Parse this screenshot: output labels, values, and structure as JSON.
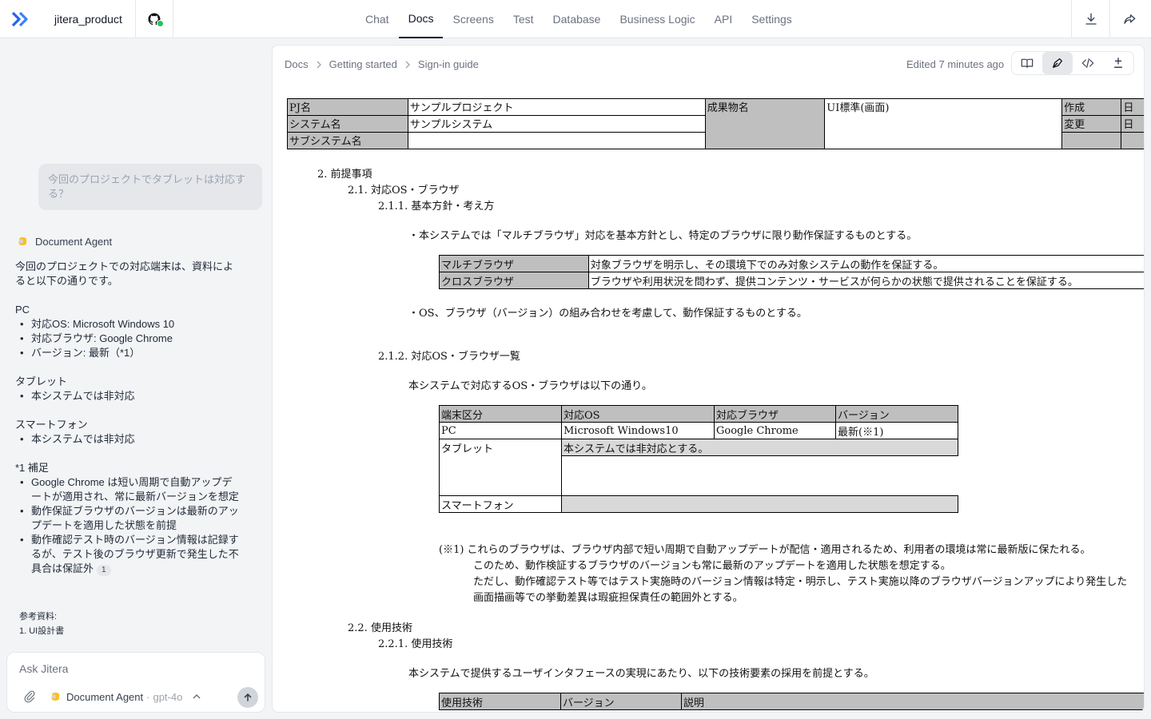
{
  "topbar": {
    "project": "jitera_product",
    "tabs": [
      {
        "label": "Chat"
      },
      {
        "label": "Docs"
      },
      {
        "label": "Screens"
      },
      {
        "label": "Test"
      },
      {
        "label": "Database"
      },
      {
        "label": "Business Logic"
      },
      {
        "label": "API"
      },
      {
        "label": "Settings"
      }
    ],
    "active_tab": "Docs"
  },
  "chat": {
    "user_message": "今回のプロジェクトでタブレットは対応する？",
    "agent_name": "Document Agent",
    "answer_intro": "今回のプロジェクトでの対応端末は、資料によると以下の通りです。",
    "pc_heading": "PC",
    "pc_items": [
      "対応OS: Microsoft Windows 10",
      "対応ブラウザ: Google Chrome",
      "バージョン: 最新（*1）"
    ],
    "tablet_heading": "タブレット",
    "tablet_items": [
      "本システムでは非対応"
    ],
    "phone_heading": "スマートフォン",
    "phone_items": [
      "本システムでは非対応"
    ],
    "note_heading": "*1 補足",
    "note_items": [
      "Google Chrome は短い周期で自動アップデートが適用され、常に最新バージョンを想定",
      "動作保証ブラウザのバージョンは最新のアップデートを適用した状態を前提",
      "動作確認テスト時のバージョン情報は記録するが、テスト後のブラウザ更新で発生した不具合は保証外"
    ],
    "citation": "1",
    "refs_label": "参考資料:",
    "refs": [
      "1. UI設計書"
    ],
    "input_placeholder": "Ask Jitera",
    "model_label": "Document Agent",
    "model_sep": "·",
    "model_name": "gpt-4o"
  },
  "doc_toolbar": {
    "breadcrumb": [
      "Docs",
      "Getting started",
      "Sign-in guide"
    ],
    "edited": "Edited 7 minutes ago"
  },
  "document": {
    "header": {
      "pj_label": "PJ名",
      "pj_value": "サンプルプロジェクト",
      "sys_label": "システム名",
      "sys_value": "サンプルシステム",
      "sub_label": "サブシステム名",
      "sub_value": "",
      "deliverable_label": "成果物名",
      "deliverable_value": "UI標準(画面)",
      "created_label": "作成",
      "changed_label": "変更",
      "created_value": "日",
      "changed_value": "日"
    },
    "s2": "2. 前提事項",
    "s21": "2.1. 対応OS・ブラウザ",
    "s211": "2.1.1. 基本方針・考え方",
    "p1": "・本システムでは「マルチブラウザ」対応を基本方針とし、特定のブラウザに限り動作保証するものとする。",
    "browser_policy": [
      {
        "term": "マルチブラウザ",
        "desc": "対象ブラウザを明示し、その環境下でのみ対象システムの動作を保証する。"
      },
      {
        "term": "クロスブラウザ",
        "desc": "ブラウザや利用状況を問わず、提供コンテンツ・サービスが何らかの状態で提供されることを保証する。"
      }
    ],
    "p2": "・OS、ブラウザ（バージョン）の組み合わせを考慮して、動作保証するものとする。",
    "s212": "2.1.2. 対応OS・ブラウザ一覧",
    "p3": "本システムで対応するOS・ブラウザは以下の通り。",
    "os_table": {
      "headers": [
        "端末区分",
        "対応OS",
        "対応ブラウザ",
        "バージョン"
      ],
      "pc": [
        "PC",
        "Microsoft Windows10",
        "Google Chrome",
        "最新(※1)"
      ],
      "tablet_label": "タブレット",
      "tablet_note": "本システムでは非対応とする。",
      "phone_label": "スマートフォン"
    },
    "note1": "(※1) これらのブラウザは、ブラウザ内部で短い周期で自動アップデートが配信・適用されるため、利用者の環境は常に最新版に保たれる。",
    "note2": "このため、動作検証するブラウザのバージョンも常に最新のアップデートを適用した状態を想定する。",
    "note3": "ただし、動作確認テスト等ではテスト実施時のバージョン情報は特定・明示し、テスト実施以降のブラウザバージョンアップにより発生した",
    "note4": "画面描画等での挙動差異は瑕疵担保責任の範囲外とする。",
    "s22": "2.2. 使用技術",
    "s221": "2.2.1. 使用技術",
    "p4": "本システムで提供するユーザインタフェースの実現にあたり、以下の技術要素の採用を前提とする。",
    "tech_headers": [
      "使用技術",
      "バージョン",
      "説明"
    ]
  }
}
